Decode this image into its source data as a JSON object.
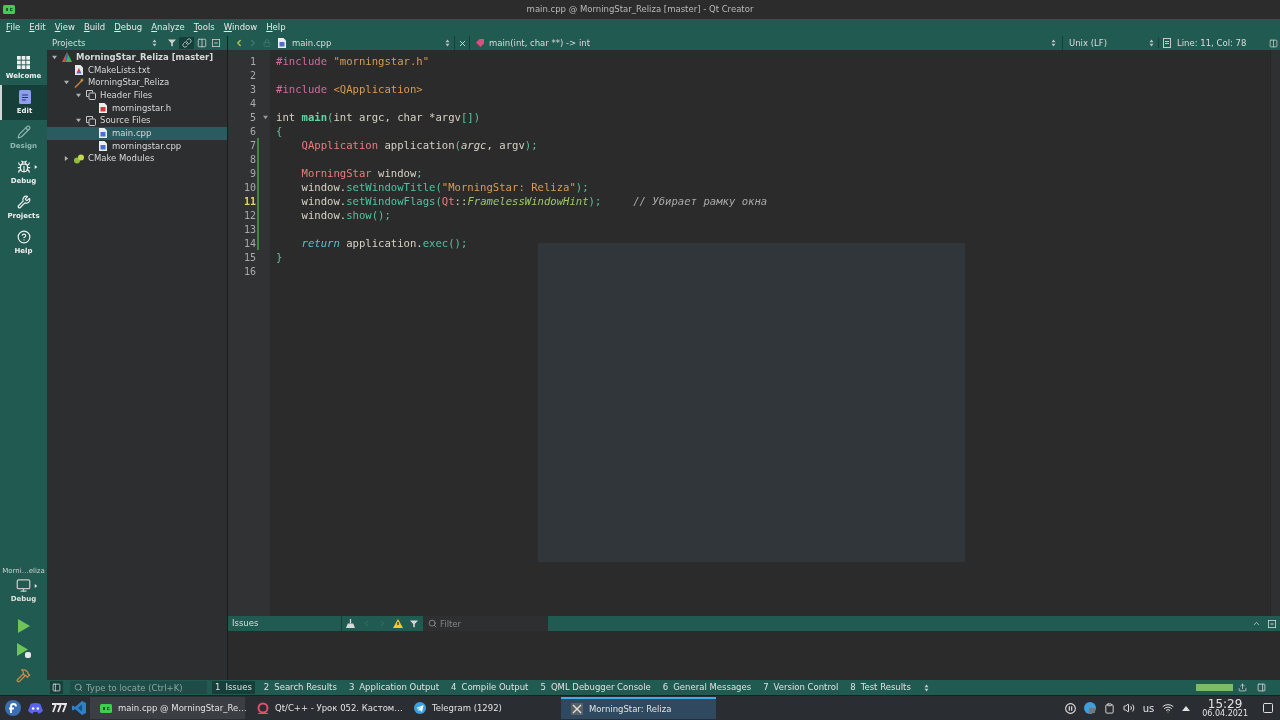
{
  "window": {
    "title": "main.cpp @ MorningStar_Reliza [master] - Qt Creator"
  },
  "menu": [
    "File",
    "Edit",
    "View",
    "Build",
    "Debug",
    "Analyze",
    "Tools",
    "Window",
    "Help"
  ],
  "mode_bar": {
    "modes": [
      {
        "label": "Welcome",
        "kind": "welcome",
        "selected": false,
        "disabled": false
      },
      {
        "label": "Edit",
        "kind": "edit",
        "selected": true,
        "disabled": false
      },
      {
        "label": "Design",
        "kind": "design",
        "selected": false,
        "disabled": true
      },
      {
        "label": "Debug",
        "kind": "debug",
        "selected": false,
        "disabled": false
      },
      {
        "label": "Projects",
        "kind": "projects",
        "selected": false,
        "disabled": false
      },
      {
        "label": "Help",
        "kind": "help",
        "selected": false,
        "disabled": false
      }
    ],
    "kit": {
      "project": "Morni…eliza",
      "build": "Debug"
    }
  },
  "projects_panel": {
    "title": "Projects",
    "tree": [
      {
        "label": "MorningStar_Reliza [master]",
        "kind": "project",
        "active": true,
        "selected": false,
        "expanded": true,
        "children": [
          {
            "label": "CMakeLists.txt",
            "kind": "cmake",
            "selected": false
          },
          {
            "label": "MorningStar_Reliza",
            "kind": "target",
            "selected": false,
            "expanded": true,
            "children": [
              {
                "label": "Header Files",
                "kind": "folder",
                "selected": false,
                "expanded": true,
                "children": [
                  {
                    "label": "morningstar.h",
                    "kind": "header",
                    "selected": false
                  }
                ]
              },
              {
                "label": "Source Files",
                "kind": "folder",
                "selected": false,
                "expanded": true,
                "children": [
                  {
                    "label": "main.cpp",
                    "kind": "source",
                    "selected": true
                  },
                  {
                    "label": "morningstar.cpp",
                    "kind": "source",
                    "selected": false
                  }
                ]
              }
            ]
          },
          {
            "label": "CMake Modules",
            "kind": "modules",
            "selected": false,
            "expanded": false
          }
        ]
      }
    ]
  },
  "editor": {
    "file": "main.cpp",
    "symbol": "main(int, char **) -> int",
    "line_ending": "Unix (LF)",
    "cursor": "Line: 11, Col: 78",
    "lines": [
      {
        "number": "1",
        "current": false,
        "modified": false,
        "tokens": [
          {
            "kind": "preprocessor",
            "text": "#include "
          },
          {
            "kind": "string",
            "text": "\"morningstar.h\""
          }
        ]
      },
      {
        "number": "2",
        "current": false,
        "modified": false
      },
      {
        "number": "3",
        "current": false,
        "modified": false,
        "tokens": [
          {
            "kind": "preprocessor",
            "text": "#include "
          },
          {
            "kind": "string",
            "text": "<QApplication>"
          }
        ]
      },
      {
        "number": "4",
        "current": false,
        "modified": false
      },
      {
        "number": "5",
        "current": false,
        "modified": false,
        "fold": {
          "expanded": true
        },
        "tokens": [
          {
            "kind": "plain",
            "text": "int "
          },
          {
            "kind": "function_decl",
            "text": "main"
          },
          {
            "kind": "punct",
            "text": "("
          },
          {
            "kind": "plain",
            "text": "int argc, char *argv"
          },
          {
            "kind": "punct",
            "text": "[])"
          }
        ]
      },
      {
        "number": "6",
        "current": false,
        "modified": false,
        "tokens": [
          {
            "kind": "punct",
            "text": "{"
          }
        ]
      },
      {
        "number": "7",
        "current": false,
        "modified": true,
        "tokens": [
          {
            "kind": "type",
            "text": "    QApplication"
          },
          {
            "kind": "plain",
            "text": " application"
          },
          {
            "kind": "punct",
            "text": "("
          },
          {
            "kind": "param",
            "text": "argc"
          },
          {
            "kind": "plain",
            "text": ", argv"
          },
          {
            "kind": "punct",
            "text": ");"
          }
        ]
      },
      {
        "number": "8",
        "current": false,
        "modified": true
      },
      {
        "number": "9",
        "current": false,
        "modified": true,
        "tokens": [
          {
            "kind": "type",
            "text": "    MorningStar"
          },
          {
            "kind": "plain",
            "text": " window"
          },
          {
            "kind": "punct",
            "text": ";"
          }
        ]
      },
      {
        "number": "10",
        "current": false,
        "modified": true,
        "tokens": [
          {
            "kind": "plain",
            "text": "    window."
          },
          {
            "kind": "function",
            "text": "setWindowTitle"
          },
          {
            "kind": "punct",
            "text": "("
          },
          {
            "kind": "string",
            "text": "\"MorningStar: Reliza\""
          },
          {
            "kind": "punct",
            "text": ");"
          }
        ]
      },
      {
        "number": "11",
        "current": true,
        "modified": true,
        "tokens": [
          {
            "kind": "plain",
            "text": "    window."
          },
          {
            "kind": "function",
            "text": "setWindowFlags"
          },
          {
            "kind": "punct",
            "text": "("
          },
          {
            "kind": "type",
            "text": "Qt"
          },
          {
            "kind": "plain",
            "text": "::"
          },
          {
            "kind": "enum",
            "text": "FramelessWindowHint"
          },
          {
            "kind": "punct",
            "text": ");"
          },
          {
            "kind": "comment",
            "text": "     // Убирает рамку окна"
          }
        ]
      },
      {
        "number": "12",
        "current": false,
        "modified": true,
        "tokens": [
          {
            "kind": "plain",
            "text": "    window."
          },
          {
            "kind": "function",
            "text": "show"
          },
          {
            "kind": "punct",
            "text": "();"
          }
        ]
      },
      {
        "number": "13",
        "current": false,
        "modified": true
      },
      {
        "number": "14",
        "current": false,
        "modified": true,
        "tokens": [
          {
            "kind": "flow_keyword",
            "text": "    return"
          },
          {
            "kind": "plain",
            "text": " application."
          },
          {
            "kind": "function",
            "text": "exec"
          },
          {
            "kind": "punct",
            "text": "();"
          }
        ]
      },
      {
        "number": "15",
        "current": false,
        "modified": false,
        "tokens": [
          {
            "kind": "punct",
            "text": "}"
          }
        ]
      },
      {
        "number": "16",
        "current": false,
        "modified": false
      }
    ]
  },
  "issues_panel": {
    "title": "Issues",
    "filter": {
      "placeholder": "Filter"
    }
  },
  "bottom_bar": {
    "locator": {
      "placeholder": "Type to locate (Ctrl+K)"
    },
    "tabs": [
      {
        "number": "1",
        "label": "Issues",
        "selected": true
      },
      {
        "number": "2",
        "label": "Search Results",
        "selected": false
      },
      {
        "number": "3",
        "label": "Application Output",
        "selected": false
      },
      {
        "number": "4",
        "label": "Compile Output",
        "selected": false
      },
      {
        "number": "5",
        "label": "QML Debugger Console",
        "selected": false
      },
      {
        "number": "6",
        "label": "General Messages",
        "selected": false
      },
      {
        "number": "7",
        "label": "Version Control",
        "selected": false
      },
      {
        "number": "8",
        "label": "Test Results",
        "selected": false
      }
    ],
    "progress": {
      "level": 1
    }
  },
  "taskbar": {
    "tasks": [
      {
        "title": "main.cpp @ MorningStar_Re…",
        "kind": "qt-creator",
        "selected": false,
        "highlighted": true
      },
      {
        "title": "Qt/C++ - Урок 052. Кастом…",
        "kind": "browser",
        "selected": false,
        "highlighted": false
      },
      {
        "title": "Telegram (1292)",
        "kind": "telegram",
        "selected": false,
        "highlighted": false
      },
      {
        "title": "MorningStar: Reliza",
        "kind": "x-window",
        "selected": true,
        "highlighted": false
      }
    ],
    "tray": {
      "layout": "us",
      "time": "15:29",
      "date": "06.04.2021"
    }
  }
}
